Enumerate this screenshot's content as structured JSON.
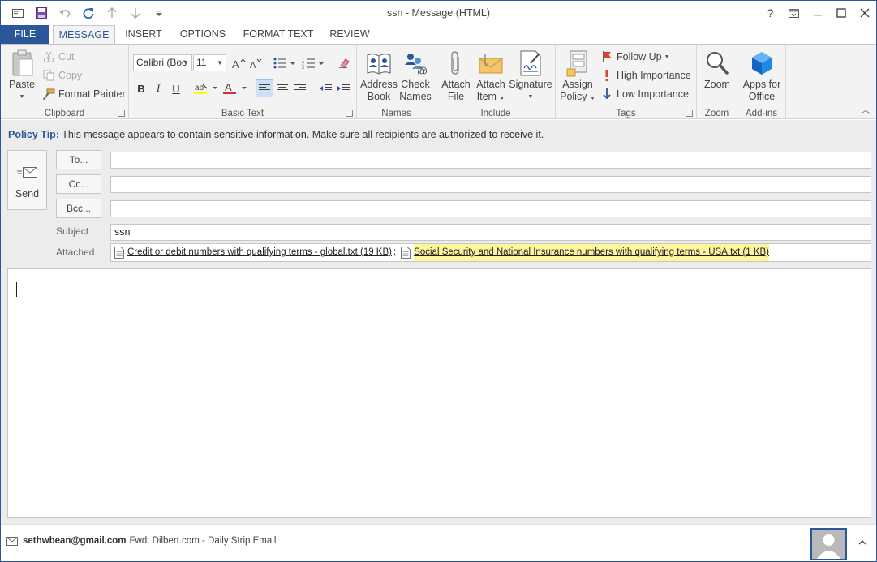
{
  "window": {
    "title": "ssn - Message (HTML)",
    "controls": [
      "?",
      "restore",
      "minimize",
      "maximize",
      "close"
    ]
  },
  "quick_access": [
    "envelope-icon",
    "save-icon",
    "undo-icon",
    "redo-icon",
    "up-arrow-icon",
    "down-arrow-icon",
    "customize-icon"
  ],
  "tabs": [
    "FILE",
    "MESSAGE",
    "INSERT",
    "OPTIONS",
    "FORMAT TEXT",
    "REVIEW"
  ],
  "active_tab": "MESSAGE",
  "ribbon": {
    "clipboard": {
      "label": "Clipboard",
      "paste": "Paste",
      "cut": "Cut",
      "copy": "Copy",
      "format_painter": "Format Painter"
    },
    "basic_text": {
      "label": "Basic Text",
      "font_name": "Calibri (Boc",
      "font_size": "11",
      "bold": "B",
      "italic": "I",
      "underline": "U"
    },
    "names": {
      "label": "Names",
      "address_book_1": "Address",
      "address_book_2": "Book",
      "check_names_1": "Check",
      "check_names_2": "Names"
    },
    "include": {
      "label": "Include",
      "attach_file_1": "Attach",
      "attach_file_2": "File",
      "attach_item_1": "Attach",
      "attach_item_2": "Item",
      "signature": "Signature"
    },
    "tags": {
      "label": "Tags",
      "assign_policy_1": "Assign",
      "assign_policy_2": "Policy",
      "follow_up": "Follow Up",
      "high_importance": "High Importance",
      "low_importance": "Low Importance"
    },
    "zoom": {
      "label": "Zoom",
      "zoom_button": "Zoom"
    },
    "addins": {
      "label": "Add-ins",
      "apps_1": "Apps for",
      "apps_2": "Office"
    }
  },
  "policy_tip": {
    "label": "Policy Tip:",
    "message": "This message appears to contain sensitive information. Make sure all recipients are authorized to receive it."
  },
  "compose": {
    "send": "Send",
    "to_button": "To...",
    "cc_button": "Cc...",
    "bcc_button": "Bcc...",
    "to_value": "",
    "cc_value": "",
    "bcc_value": "",
    "subject_label": "Subject",
    "subject_value": "ssn",
    "attached_label": "Attached",
    "attachments": [
      {
        "name": "Credit or debit numbers with qualifying terms - global.txt (19 KB)",
        "separator": ";"
      },
      {
        "name": "Social Security and National Insurance numbers with qualifying terms - USA.txt (1 KB)",
        "highlighted": true
      }
    ]
  },
  "status": {
    "email": "sethwbean@gmail.com",
    "subject": "Fwd: Dilbert.com - Daily Strip Email"
  },
  "colors": {
    "accent": "#2b579a",
    "ribbon_bg": "#f3f3f3",
    "highlight": "#fff59d",
    "font_color_red": "#d32f2f",
    "highlight_yellow": "#ffff00",
    "apps_blue": "#1e88e5"
  }
}
